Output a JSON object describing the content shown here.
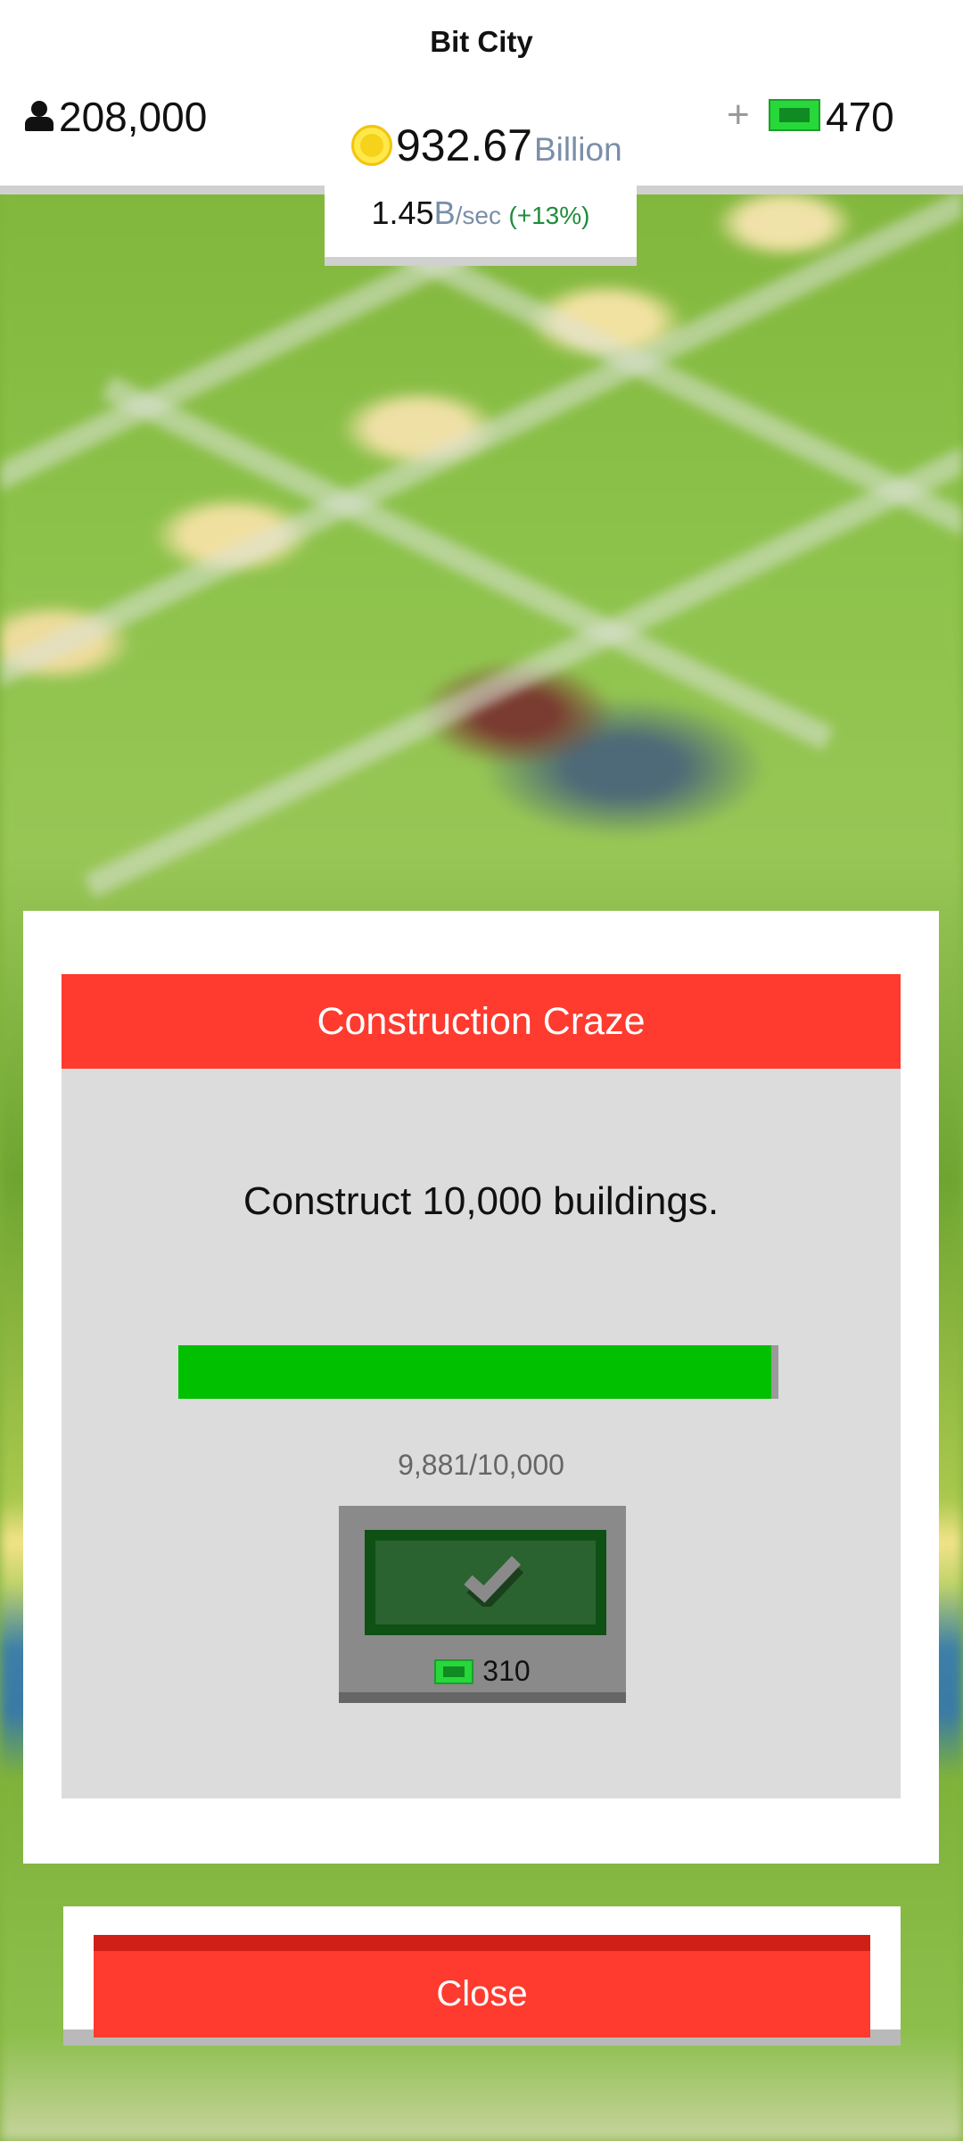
{
  "header": {
    "title": "Bit City",
    "population": "208,000",
    "cash_value": "932.67",
    "cash_unit": "Billion",
    "rate_value": "1.45",
    "rate_unit": "B",
    "rate_per": "/sec",
    "rate_bonus": "(+13%)",
    "plus_label": "+",
    "bucks": "470"
  },
  "dialog": {
    "title": "Construction Craze",
    "description": "Construct 10,000 buildings.",
    "progress_current": 9881,
    "progress_goal": 10000,
    "progress_text": "9,881/10,000",
    "reward_amount": "310"
  },
  "close_label": "Close",
  "colors": {
    "accent_red": "#ff3a2e",
    "progress_green": "#00c000",
    "bucks_green": "#27d83a"
  }
}
